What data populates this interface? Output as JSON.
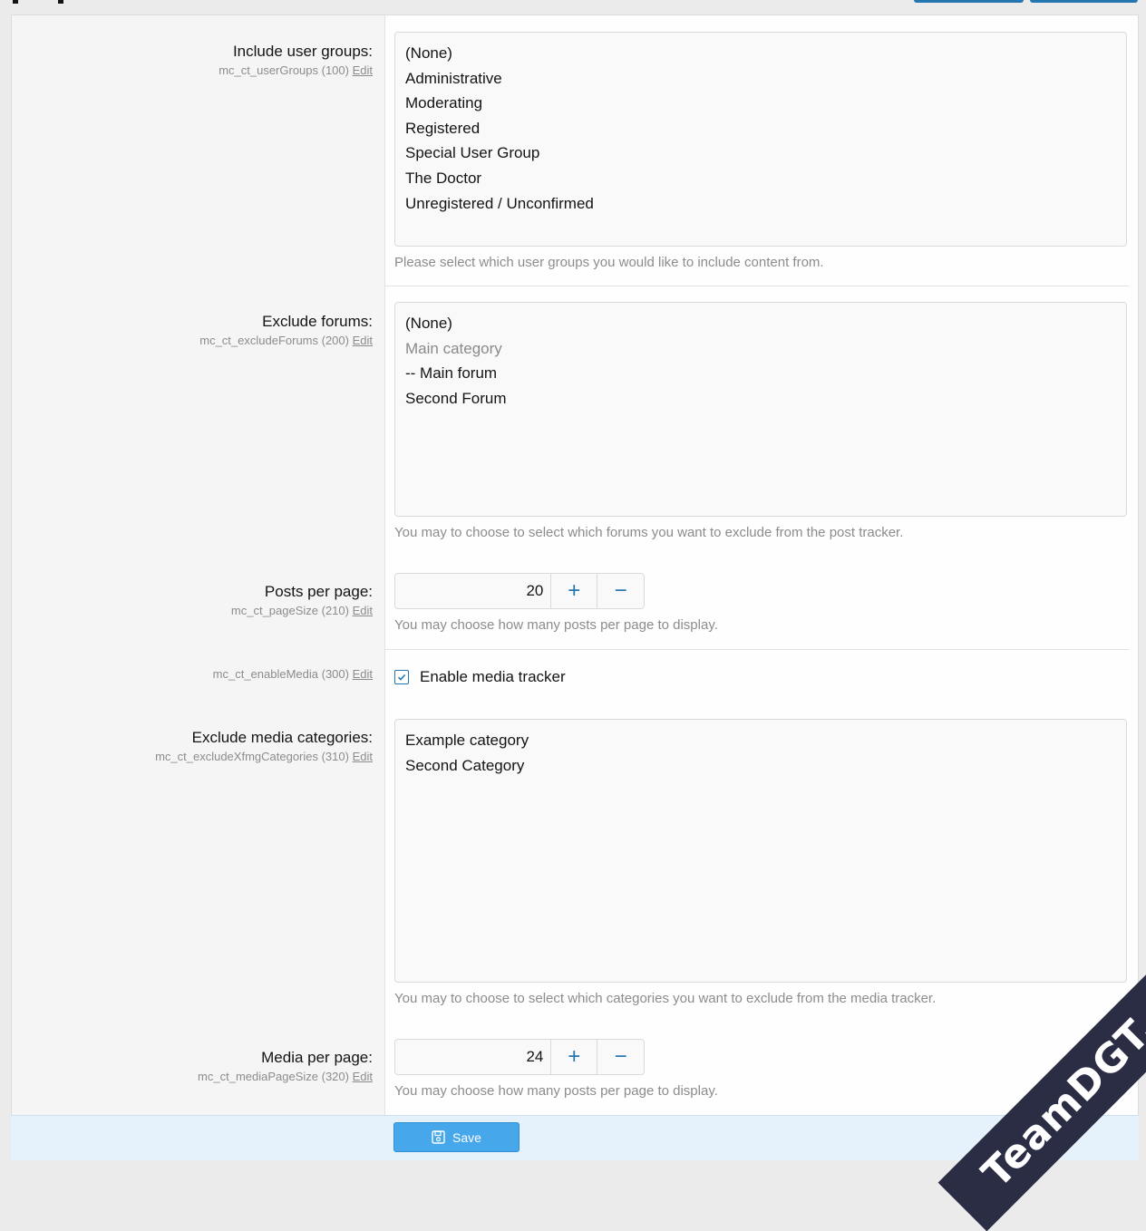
{
  "options": {
    "user_groups": {
      "label": "Include user groups:",
      "key": "mc_ct_userGroups (100)",
      "edit": "Edit",
      "items": [
        {
          "text": "(None)",
          "muted": false
        },
        {
          "text": "Administrative",
          "muted": false
        },
        {
          "text": "Moderating",
          "muted": false
        },
        {
          "text": "Registered",
          "muted": false
        },
        {
          "text": "Special User Group",
          "muted": false
        },
        {
          "text": "The Doctor",
          "muted": false
        },
        {
          "text": "Unregistered / Unconfirmed",
          "muted": false
        }
      ],
      "explain": "Please select which user groups you would like to include content from."
    },
    "exclude_forums": {
      "label": "Exclude forums:",
      "key": "mc_ct_excludeForums (200)",
      "edit": "Edit",
      "items": [
        {
          "text": "(None)",
          "muted": false
        },
        {
          "text": "Main category",
          "muted": true
        },
        {
          "text": "-- Main forum",
          "muted": false
        },
        {
          "text": "Second Forum",
          "muted": false
        }
      ],
      "explain": "You may to choose to select which forums you want to exclude from the post tracker."
    },
    "posts_per_page": {
      "label": "Posts per page:",
      "key": "mc_ct_pageSize (210)",
      "edit": "Edit",
      "value": "20",
      "plus": "+",
      "minus": "−",
      "explain": "You may choose how many posts per page to display."
    },
    "enable_media": {
      "key": "mc_ct_enableMedia (300)",
      "edit": "Edit",
      "checkbox_label": "Enable media tracker",
      "checked": true
    },
    "exclude_media_categories": {
      "label": "Exclude media categories:",
      "key": "mc_ct_excludeXfmgCategories (310)",
      "edit": "Edit",
      "items": [
        {
          "text": "Example category",
          "muted": false
        },
        {
          "text": "Second Category",
          "muted": false
        }
      ],
      "explain": "You may to choose to select which categories you want to exclude from the media tracker."
    },
    "media_per_page": {
      "label": "Media per page:",
      "key": "mc_ct_mediaPageSize (320)",
      "edit": "Edit",
      "value": "24",
      "plus": "+",
      "minus": "−",
      "explain": "You may choose how many posts per page to display."
    }
  },
  "footer": {
    "save_label": "Save",
    "save_icon": "save-icon"
  },
  "watermark": "TeamDGT.org",
  "colors": {
    "accent": "#2577b1",
    "button": "#47a7eb",
    "footer_bg": "#e5f1fb",
    "watermark_bg": "#2a2d43"
  }
}
